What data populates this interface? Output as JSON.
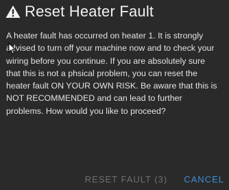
{
  "dialog": {
    "title": "Reset Heater Fault",
    "icon": "warning-icon",
    "message": "A heater fault has occurred on heater 1. It is strongly advised to turn off your machine now and to check your wiring before you continue. If you are absolutely sure that this is not a phsical problem, you can reset the heater fault ON YOUR OWN RISK. Be aware that this is NOT RECOMMENDED and can lead to further problems. How would you like to proceed?"
  },
  "actions": {
    "reset_label": "RESET FAULT (3)",
    "cancel_label": "CANCEL"
  },
  "colors": {
    "background": "#2a2a2a",
    "text": "#e3e3e3",
    "disabled": "#6f6f6f",
    "accent": "#3d8fd6"
  }
}
